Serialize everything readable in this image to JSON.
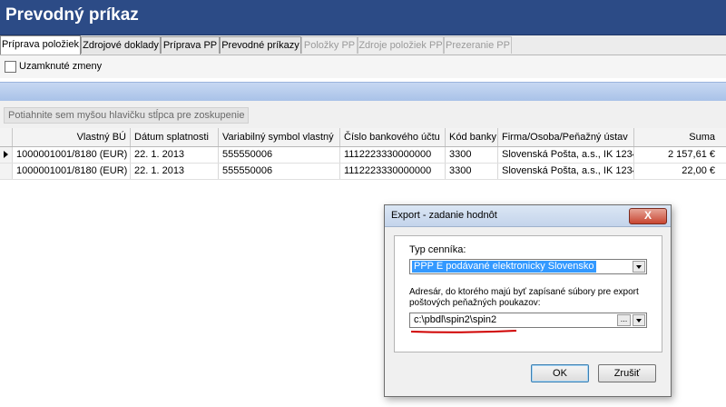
{
  "window": {
    "title": "Prevodný príkaz"
  },
  "tabs": [
    {
      "label": "Príprava položiek",
      "state": "active"
    },
    {
      "label": "Zdrojové doklady",
      "state": "normal"
    },
    {
      "label": "Príprava PP",
      "state": "normal"
    },
    {
      "label": "Prevodné príkazy",
      "state": "normal"
    },
    {
      "label": "Položky PP",
      "state": "disabled"
    },
    {
      "label": "Zdroje položiek PP",
      "state": "disabled"
    },
    {
      "label": "Prezeranie PP",
      "state": "disabled"
    }
  ],
  "toolbar": {
    "locked_changes_label": "Uzamknuté zmeny",
    "locked_changes_checked": false
  },
  "grid": {
    "group_hint": "Potiahnite sem myšou hlavičku stĺpca pre zoskupenie",
    "columns": [
      "Vlastný BÚ",
      "Dátum splatnosti",
      "Variabilný symbol vlastný",
      "Číslo bankového účtu",
      "Kód banky",
      "Firma/Osoba/Peňažný ústav",
      "Suma"
    ],
    "rows": [
      {
        "current": true,
        "cells": [
          "1000001001/8180 (EUR)",
          "22. 1. 2013",
          "555550006",
          "1112223330000000",
          "3300",
          "Slovenská Pošta, a.s., IK 1234...",
          "2 157,61 €"
        ]
      },
      {
        "current": false,
        "cells": [
          "1000001001/8180 (EUR)",
          "22. 1. 2013",
          "555550006",
          "1112223330000000",
          "3300",
          "Slovenská Pošta, a.s., IK 1234...",
          "22,00 €"
        ]
      }
    ]
  },
  "dialog": {
    "title": "Export - zadanie hodnôt",
    "close_glyph": "X",
    "price_type_label": "Typ cenníka:",
    "price_type_value": "PPP E podávané elektronicky Slovensko",
    "folder_label_line1": "Adresár, do ktorého majú byť zapísané súbory pre export",
    "folder_label_line2": "poštových peňažných poukazov:",
    "folder_value": "c:\\pbdl\\spin2\\spin2",
    "browse_label": "...",
    "ok_label": "OK",
    "cancel_label": "Zrušiť"
  },
  "colors": {
    "title_bar": "#2c4b86",
    "selection": "#3399ff",
    "annotation": "#d00000"
  }
}
